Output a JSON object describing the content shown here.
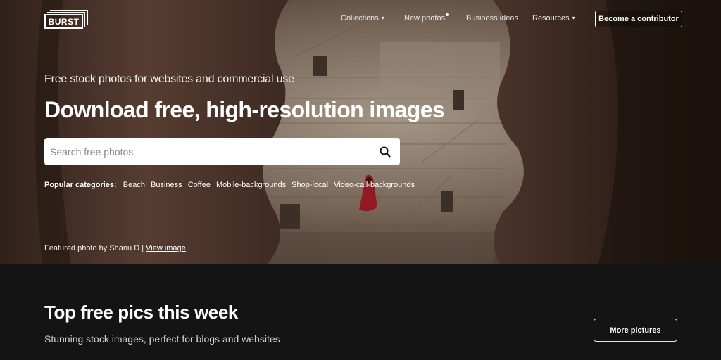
{
  "header": {
    "logo_text": "BURST",
    "nav": {
      "collections": "Collections",
      "new_photos": "New photos",
      "business_ideas": "Business ideas",
      "resources": "Resources"
    },
    "contributor_button": "Become a contributor"
  },
  "hero": {
    "subtitle": "Free stock photos for websites and commercial use",
    "headline": "Download free, high-resolution images",
    "search_placeholder": "Search free photos",
    "categories_label": "Popular categories:",
    "categories": [
      "Beach",
      "Business",
      "Coffee",
      "Mobile-backgrounds",
      "Shop-local",
      "Video-call-backgrounds"
    ],
    "featured_text": "Featured photo by Shanu D |",
    "featured_link": "View image"
  },
  "section": {
    "title": "Top free pics this week",
    "subtitle": "Stunning stock images, perfect for blogs and websites",
    "more_button": "More pictures"
  },
  "icons": {
    "search": "search-icon",
    "caret": "chevron-down-icon",
    "new_dot": "notification-dot-icon"
  },
  "colors": {
    "page_background": "#141414",
    "button_border": "#ffffff"
  }
}
